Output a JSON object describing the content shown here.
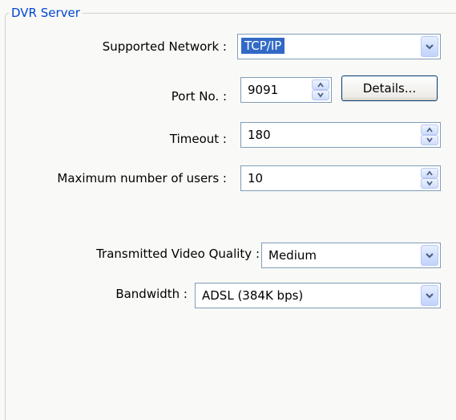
{
  "group": {
    "title": "DVR Server"
  },
  "network": {
    "label": "Supported Network :",
    "value": "TCP/IP"
  },
  "port": {
    "label": "Port No. :",
    "value": "9091",
    "details_button": "Details..."
  },
  "timeout": {
    "label": "Timeout :",
    "value": "180"
  },
  "max_users": {
    "label": "Maximum number of users :",
    "value": "10"
  },
  "video_quality": {
    "label": "Transmitted Video Quality :",
    "value": "Medium"
  },
  "bandwidth": {
    "label": "Bandwidth :",
    "value": "ADSL (384K bps)"
  },
  "colors": {
    "legend": "#0046d5",
    "selection": "#316ac5",
    "field_border": "#7f9db9",
    "button_border": "#003c74"
  },
  "icons": {
    "combo": "chevron-down-icon",
    "spin": "spin-up-down-icon"
  }
}
